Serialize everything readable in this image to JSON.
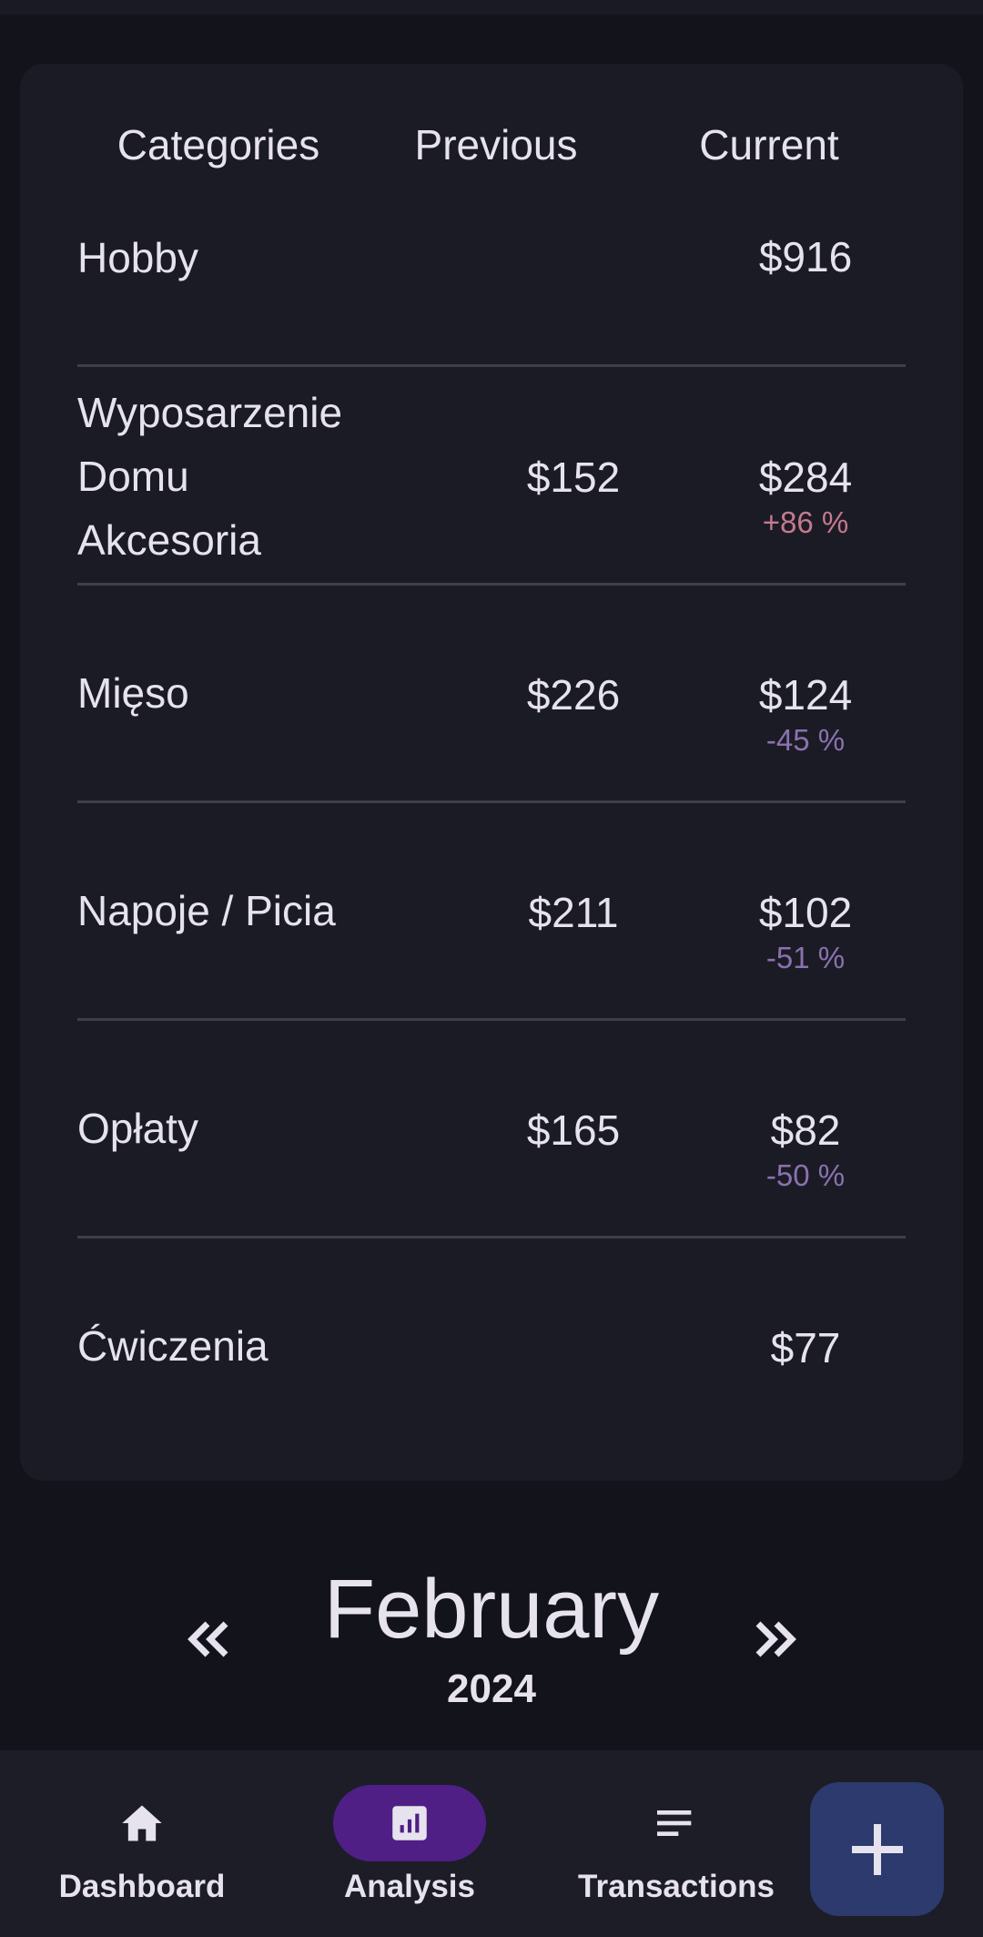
{
  "table": {
    "headers": {
      "category": "Categories",
      "previous": "Previous",
      "current": "Current"
    },
    "rows": [
      {
        "category": "Hobby",
        "previous": "",
        "current": "$916",
        "change": "",
        "trend": ""
      },
      {
        "category": "Wyposarzenie Domu Akcesoria",
        "previous": "$152",
        "current": "$284",
        "change": "+86 %",
        "trend": "up"
      },
      {
        "category": "Mięso",
        "previous": "$226",
        "current": "$124",
        "change": "-45 %",
        "trend": "down"
      },
      {
        "category": "Napoje / Picia",
        "previous": "$211",
        "current": "$102",
        "change": "-51 %",
        "trend": "down"
      },
      {
        "category": "Opłaty",
        "previous": "$165",
        "current": "$82",
        "change": "-50 %",
        "trend": "down"
      },
      {
        "category": "Ćwiczenia",
        "previous": "",
        "current": "$77",
        "change": "",
        "trend": ""
      }
    ]
  },
  "period": {
    "month": "February",
    "year": "2024"
  },
  "nav": {
    "items": [
      {
        "label": "Dashboard",
        "icon": "home-icon",
        "active": false
      },
      {
        "label": "Analysis",
        "icon": "analytics-icon",
        "active": true
      },
      {
        "label": "Transactions",
        "icon": "list-icon",
        "active": false
      }
    ],
    "fab_icon": "plus-icon"
  },
  "colors": {
    "increase": "#c47a8c",
    "decrease": "#8a72ad",
    "active_nav": "#4f1f86",
    "fab": "#2c3a6d"
  }
}
